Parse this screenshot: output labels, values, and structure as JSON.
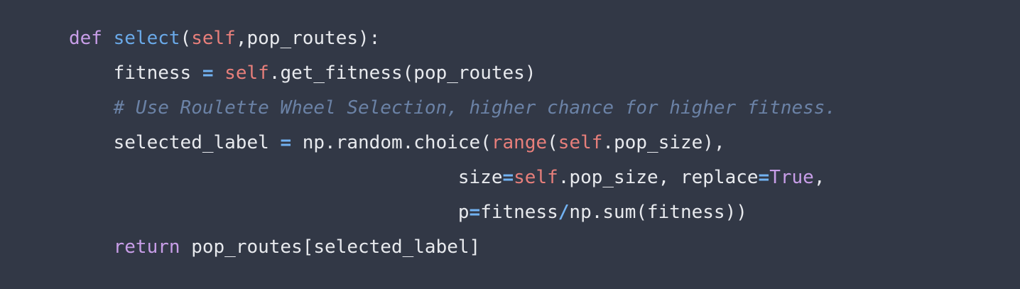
{
  "code": {
    "language": "python",
    "lines": [
      {
        "indent": "",
        "tokens": [
          {
            "text": "def",
            "type": "keyword"
          },
          {
            "text": " ",
            "type": "text"
          },
          {
            "text": "select",
            "type": "function"
          },
          {
            "text": "(",
            "type": "text"
          },
          {
            "text": "self",
            "type": "self"
          },
          {
            "text": ",pop_routes):",
            "type": "text"
          }
        ]
      },
      {
        "indent": "    ",
        "tokens": [
          {
            "text": "fitness ",
            "type": "text"
          },
          {
            "text": "=",
            "type": "operator"
          },
          {
            "text": " ",
            "type": "text"
          },
          {
            "text": "self",
            "type": "self"
          },
          {
            "text": ".get_fitness(pop_routes)",
            "type": "text"
          }
        ]
      },
      {
        "indent": "    ",
        "tokens": [
          {
            "text": "# Use Roulette Wheel Selection, higher chance for higher fitness.",
            "type": "comment"
          }
        ]
      },
      {
        "indent": "    ",
        "tokens": [
          {
            "text": "selected_label ",
            "type": "text"
          },
          {
            "text": "=",
            "type": "operator"
          },
          {
            "text": " np.random.choice(",
            "type": "text"
          },
          {
            "text": "range",
            "type": "builtin"
          },
          {
            "text": "(",
            "type": "text"
          },
          {
            "text": "self",
            "type": "self"
          },
          {
            "text": ".pop_size),",
            "type": "text"
          }
        ]
      },
      {
        "indent": "                                   ",
        "tokens": [
          {
            "text": "size",
            "type": "text"
          },
          {
            "text": "=",
            "type": "operator"
          },
          {
            "text": "self",
            "type": "self"
          },
          {
            "text": ".pop_size, replace",
            "type": "text"
          },
          {
            "text": "=",
            "type": "operator"
          },
          {
            "text": "True",
            "type": "const"
          },
          {
            "text": ",",
            "type": "text"
          }
        ]
      },
      {
        "indent": "                                   ",
        "tokens": [
          {
            "text": "p",
            "type": "text"
          },
          {
            "text": "=",
            "type": "operator"
          },
          {
            "text": "fitness",
            "type": "text"
          },
          {
            "text": "/",
            "type": "operator"
          },
          {
            "text": "np.sum(fitness))",
            "type": "text"
          }
        ]
      },
      {
        "indent": "    ",
        "tokens": [
          {
            "text": "return",
            "type": "keyword"
          },
          {
            "text": " pop_routes[selected_label]",
            "type": "text"
          }
        ]
      }
    ]
  },
  "colors": {
    "background": "#323846",
    "text": "#e8eaee",
    "keyword": "#c89ee8",
    "function": "#6aa9e8",
    "self": "#e87f7b",
    "operator": "#72b2f2",
    "comment": "#6b82a6"
  }
}
